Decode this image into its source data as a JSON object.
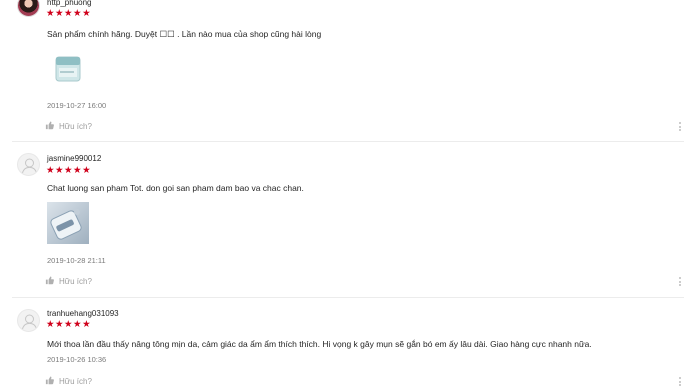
{
  "reviews": [
    {
      "username": "http_phuong",
      "stars": "★★★★★",
      "comment": "Sản phẩm chính hãng. Duyệt ☐☐ . Lần nào mua của shop cũng hài lòng",
      "date": "2019-10-27 16:00",
      "helpful_label": "Hữu ích?"
    },
    {
      "username": "jasmine990012",
      "stars": "★★★★★",
      "comment": "Chat luong san pham Tot. don goi san pham dam bao va chac chan.",
      "date": "2019-10-28 21:11",
      "helpful_label": "Hữu ích?"
    },
    {
      "username": "tranhuehang031093",
      "stars": "★★★★★",
      "comment": "Mới thoa lần đầu thấy nâng tông mịn da, cảm giác da ẩm ẩm thích thích. Hi vọng k gây mụn sẽ gắn bó em ấy lâu dài. Giao hàng cực nhanh nữa.",
      "date": "2019-10-26 10:36",
      "helpful_label": "Hữu ích?"
    }
  ],
  "colors": {
    "star": "#d0011b",
    "muted": "#9e9e9e",
    "separator": "#ececec"
  }
}
